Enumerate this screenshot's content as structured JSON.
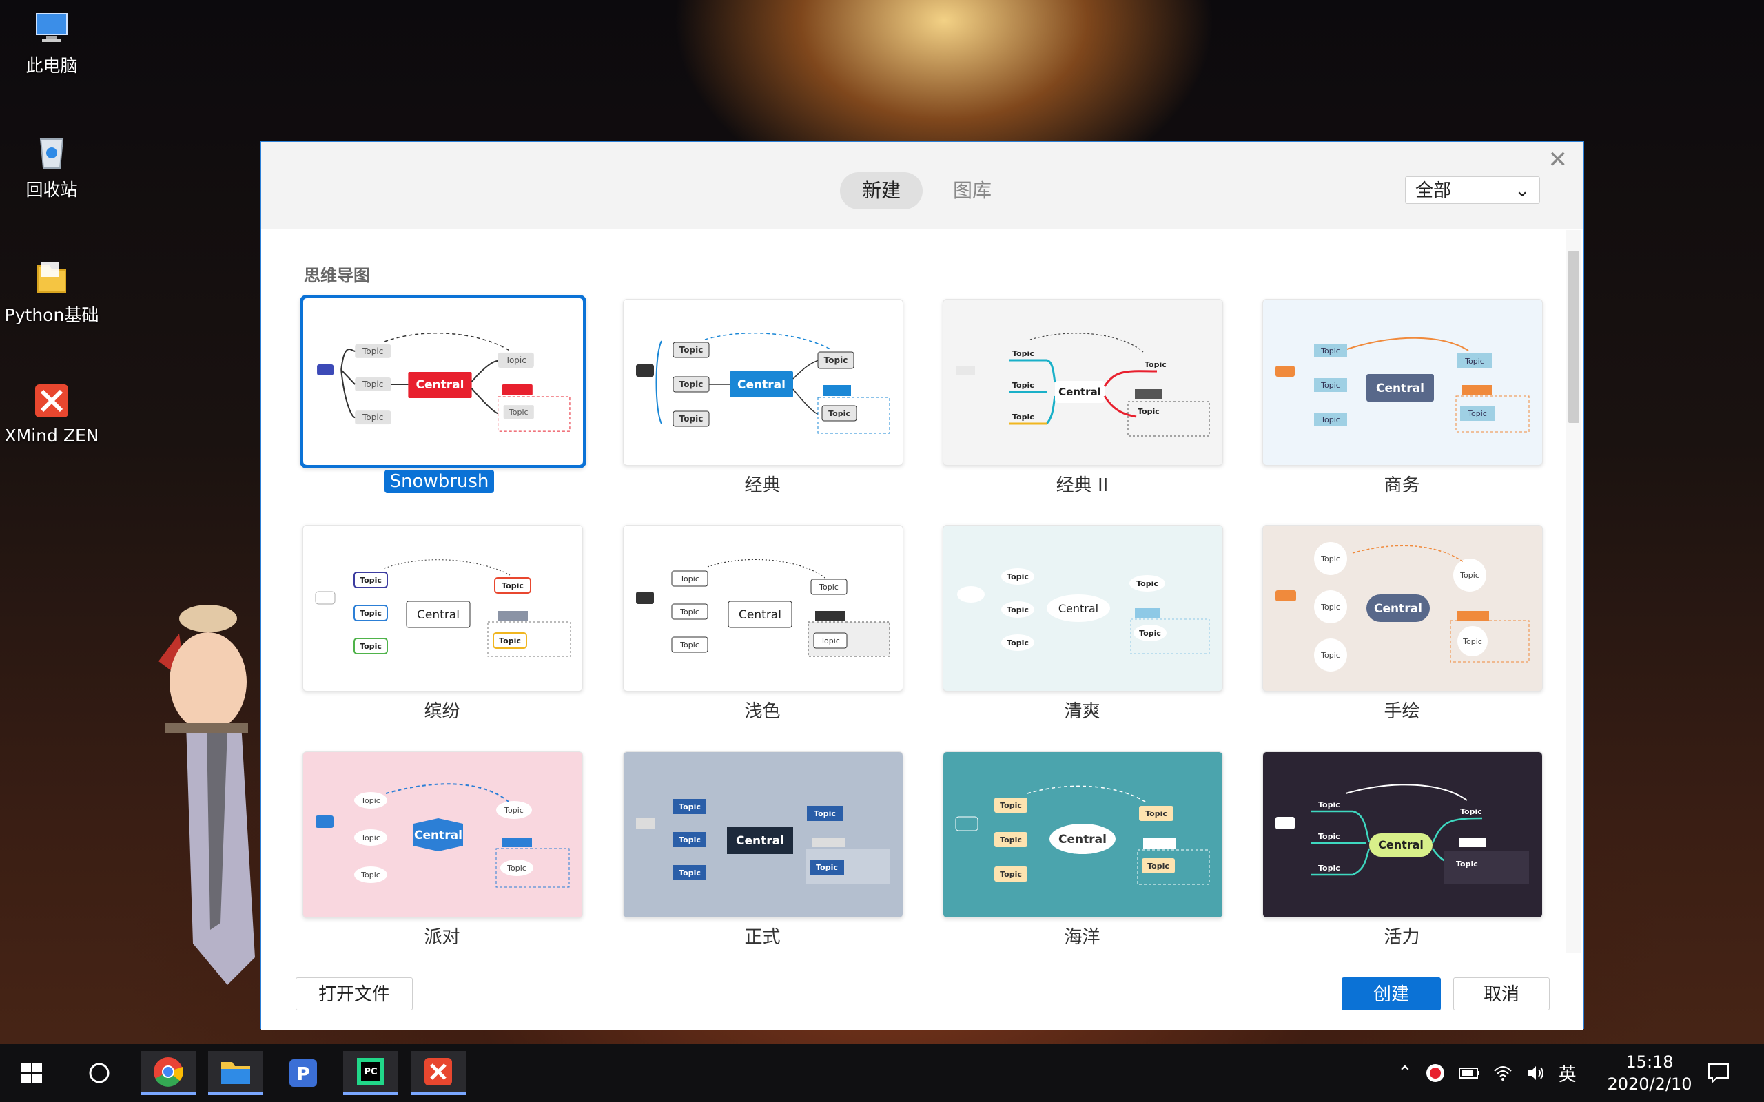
{
  "desktop": {
    "icons": [
      {
        "label": "此电脑",
        "icon": "computer-icon"
      },
      {
        "label": "回收站",
        "icon": "recycle-bin-icon"
      },
      {
        "label": "Python基础",
        "icon": "folder-icon"
      },
      {
        "label": "XMind ZEN",
        "icon": "xmind-icon"
      }
    ]
  },
  "dialog": {
    "tabs": [
      {
        "label": "新建",
        "active": true
      },
      {
        "label": "图库",
        "active": false
      }
    ],
    "filter": {
      "selected": "全部"
    },
    "section_title": "思维导图",
    "templates": [
      {
        "name": "Snowbrush",
        "selected": true
      },
      {
        "name": "经典",
        "selected": false
      },
      {
        "name": "经典 II",
        "selected": false
      },
      {
        "name": "商务",
        "selected": false
      },
      {
        "name": "缤纷",
        "selected": false
      },
      {
        "name": "浅色",
        "selected": false
      },
      {
        "name": "清爽",
        "selected": false
      },
      {
        "name": "手绘",
        "selected": false
      },
      {
        "name": "派对",
        "selected": false
      },
      {
        "name": "正式",
        "selected": false
      },
      {
        "name": "海洋",
        "selected": false
      },
      {
        "name": "活力",
        "selected": false
      }
    ],
    "preview_text": {
      "central": "Central",
      "topic": "Topic",
      "subtopic": "topic"
    },
    "footer": {
      "open_file": "打开文件",
      "create": "创建",
      "cancel": "取消"
    }
  },
  "taskbar": {
    "apps": [
      "windows-start-icon",
      "cortana-icon",
      "chrome-icon",
      "file-explorer-icon",
      "pycharm-edu-icon",
      "pycharm-icon",
      "xmind-icon"
    ],
    "ime": "英",
    "time": "15:18",
    "date": "2020/2/10"
  },
  "colors": {
    "accent": "#0b72d6",
    "snowbrush_central": "#e8202e",
    "classic_central": "#1a87d6"
  }
}
